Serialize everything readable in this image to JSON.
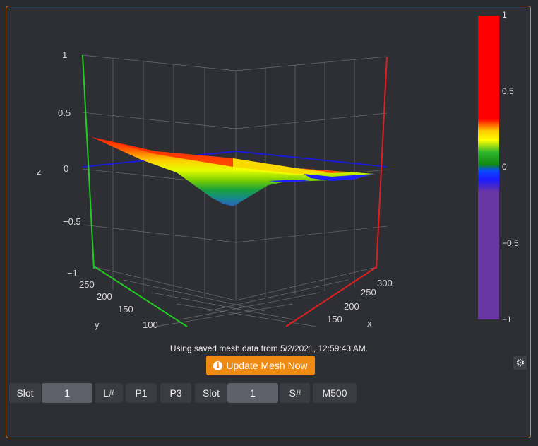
{
  "plot": {
    "z_ticks": [
      "1",
      "0.5",
      "0",
      "−0.5",
      "−1"
    ],
    "z_label": "z",
    "y_ticks": [
      "250",
      "200",
      "150",
      "100"
    ],
    "y_label": "y",
    "x_ticks": [
      "300",
      "250",
      "200",
      "150"
    ],
    "x_label": "x",
    "colorbar_ticks": [
      "1",
      "0.5",
      "0",
      "−0.5",
      "−1"
    ],
    "colors": {
      "z_axis": "#22cc22",
      "x_axis": "#dd1f1f",
      "y_axis": "#22cc22",
      "zero_plane": "#1a1ad6",
      "grid": "#6b6d73"
    }
  },
  "status_text": "Using saved mesh data from 5/2/2021, 12:59:43 AM.",
  "update_button": {
    "label": "Update Mesh Now",
    "icon": "info-circle-icon"
  },
  "settings_icon": "gear-icon",
  "controls": {
    "slot_label_1": "Slot",
    "slot_value_1": "1",
    "load_button": "L#",
    "p1_button": "P1",
    "p3_button": "P3",
    "slot_label_2": "Slot",
    "slot_value_2": "1",
    "save_button": "S#",
    "m500_button": "M500"
  }
}
